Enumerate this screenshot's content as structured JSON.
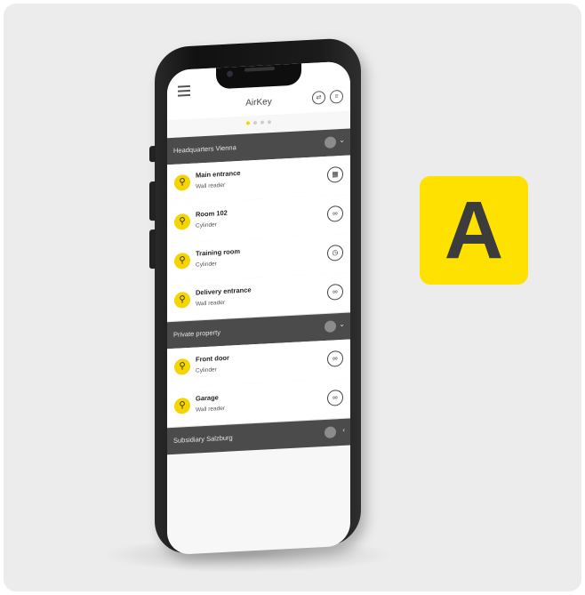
{
  "app": {
    "title": "AirKey"
  },
  "colors": {
    "accent": "#f5d400",
    "section_bar": "#4b4b4b",
    "background": "#ececec"
  },
  "pager": {
    "pages": 4,
    "active": 1
  },
  "sections": [
    {
      "label": "Headquarters Vienna"
    },
    {
      "label": "Private property"
    },
    {
      "label": "Subsidiary Salzburg"
    }
  ],
  "devices": [
    {
      "name": "Main entrance",
      "type": "Wall reader",
      "action_icon": "calendar-icon",
      "action_glyph": "▦"
    },
    {
      "name": "Room 102",
      "type": "Cylinder",
      "action_icon": "infinity-icon",
      "action_glyph": "∞"
    },
    {
      "name": "Training room",
      "type": "Cylinder",
      "action_icon": "clock-icon",
      "action_glyph": "◷"
    },
    {
      "name": "Delivery entrance",
      "type": "Wall reader",
      "action_icon": "infinity-icon",
      "action_glyph": "∞"
    },
    {
      "name": "Front door",
      "type": "Cylinder",
      "action_icon": "infinity-icon",
      "action_glyph": "∞"
    },
    {
      "name": "Garage",
      "type": "Wall reader",
      "action_icon": "infinity-icon",
      "action_glyph": "∞"
    }
  ],
  "icons": {
    "key": "⚲",
    "chevron_down": "⌄",
    "chevron_left": "‹"
  },
  "logo": {
    "letter": "A",
    "color": "#ffe100"
  }
}
